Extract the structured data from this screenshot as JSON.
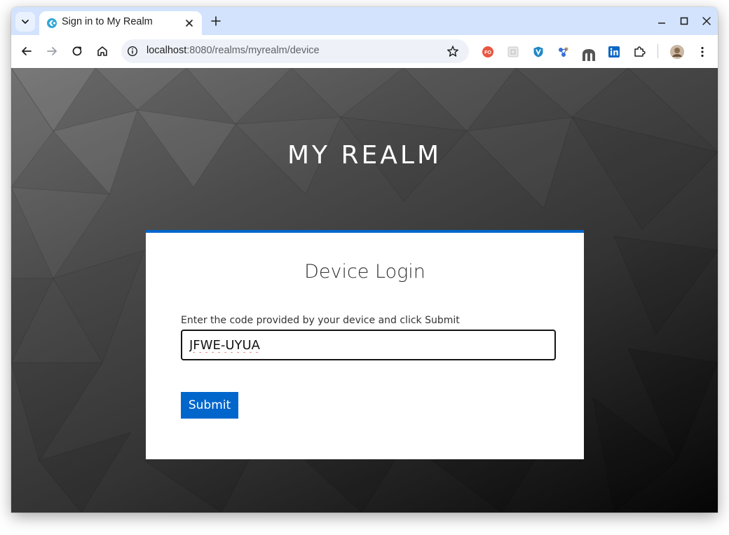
{
  "browser": {
    "tab_title": "Sign in to My Realm",
    "url_host": "localhost",
    "url_rest": ":8080/realms/myrealm/device",
    "extensions": [
      "fo-extension-icon",
      "grid-extension-icon",
      "shield-extension-icon",
      "molecule-extension-icon",
      "mastodon-extension-icon",
      "linkedin-extension-icon",
      "puzzle-icon"
    ],
    "colors": {
      "tabstrip": "#d3e3fd",
      "omnibox": "#eef2f8"
    }
  },
  "page": {
    "realm_title": "MY REALM",
    "card_title": "Device Login",
    "code_label": "Enter the code provided by your device and click Submit",
    "code_value": "JFWE-UYUA",
    "submit_label": "Submit",
    "colors": {
      "accent": "#0066cc",
      "input_border": "#151515"
    }
  }
}
